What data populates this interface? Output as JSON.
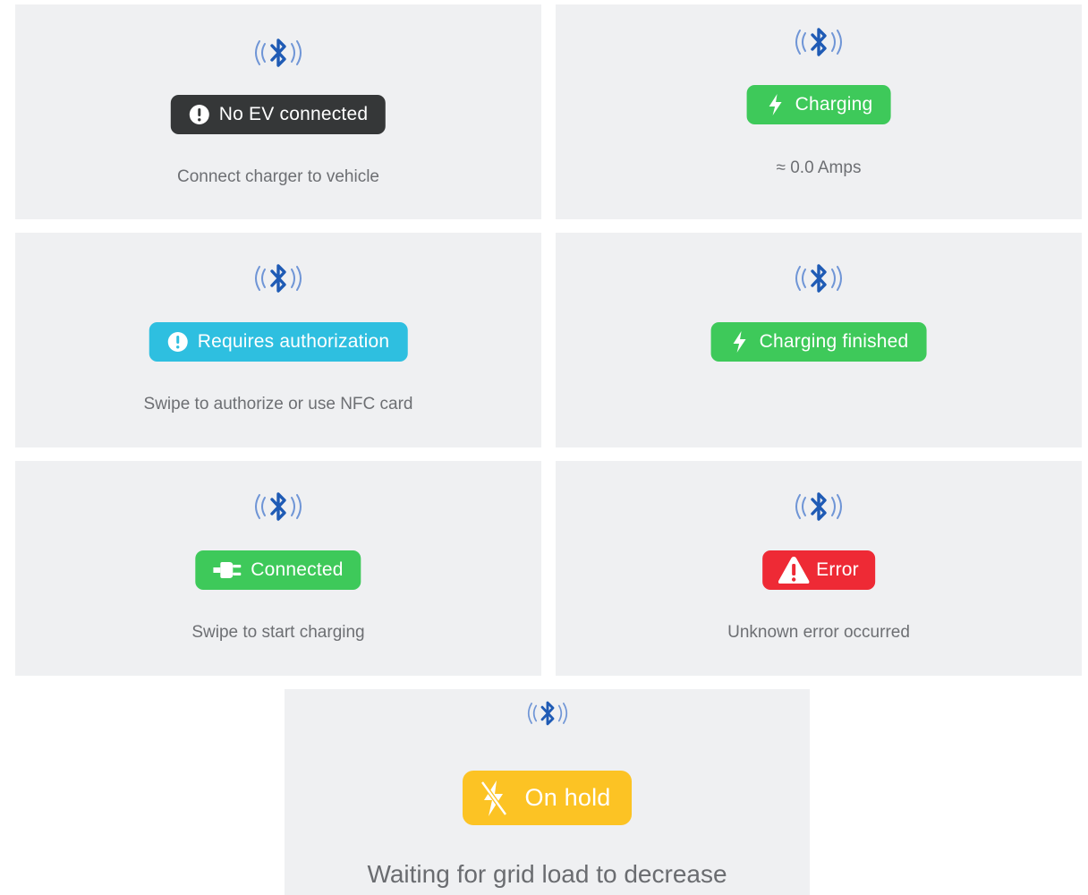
{
  "colors": {
    "card_bg": "#eff0f2",
    "bluetooth": "#1f5bb5",
    "dark": "#353738",
    "green": "#3ec95a",
    "cyan": "#2ebfe0",
    "red": "#ee2a35",
    "yellow": "#fcc324",
    "subtitle": "#6d6f73"
  },
  "cards": [
    {
      "status_icon": "exclamation-circle-icon",
      "status_label": "No EV connected",
      "status_color": "#353738",
      "subtitle": "Connect charger to vehicle"
    },
    {
      "status_icon": "lightning-bolt-icon",
      "status_label": "Charging",
      "status_color": "#3ec95a",
      "subtitle": "≈ 0.0 Amps"
    },
    {
      "status_icon": "exclamation-circle-icon",
      "status_label": "Requires authorization",
      "status_color": "#2ebfe0",
      "subtitle": "Swipe to authorize or use NFC card"
    },
    {
      "status_icon": "lightning-bolt-icon",
      "status_label": "Charging finished",
      "status_color": "#3ec95a",
      "subtitle": ""
    },
    {
      "status_icon": "plug-icon",
      "status_label": "Connected",
      "status_color": "#3ec95a",
      "subtitle": "Swipe to start charging"
    },
    {
      "status_icon": "warning-triangle-icon",
      "status_label": "Error",
      "status_color": "#ee2a35",
      "subtitle": "Unknown error occurred"
    },
    {
      "status_icon": "lightning-off-icon",
      "status_label": "On hold",
      "status_color": "#fcc324",
      "subtitle": "Waiting for grid load to decrease"
    }
  ]
}
